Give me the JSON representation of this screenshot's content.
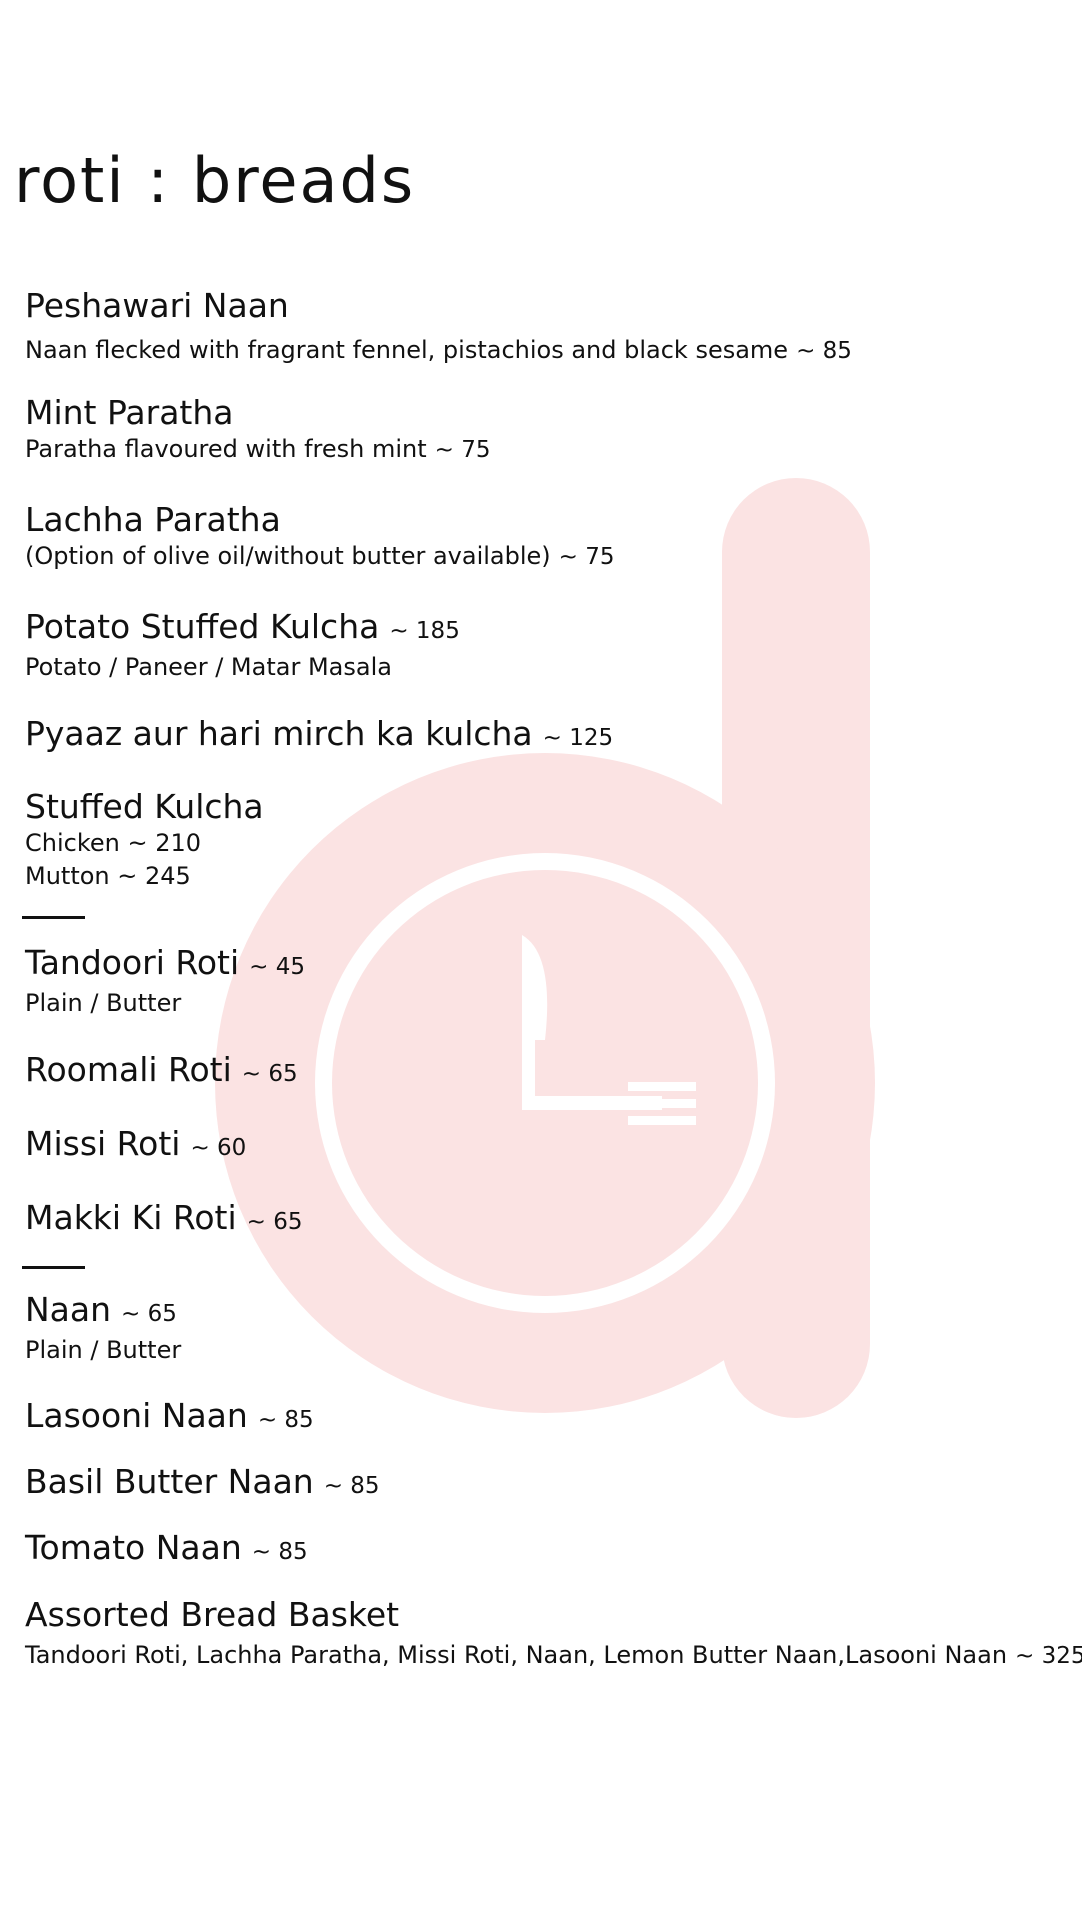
{
  "menu": {
    "title": "roti  :  breads",
    "items": [
      {
        "name": "Peshawari Naan",
        "desc": "Naan flecked with fragrant fennel, pistachios and black sesame",
        "desc_price": "~ 85"
      },
      {
        "name": "Mint Paratha",
        "desc": "Paratha flavoured with fresh mint",
        "desc_price": "~ 75"
      },
      {
        "name": "Lachha Paratha",
        "desc": "(Option of olive oil/without butter available)",
        "desc_price": "~ 75"
      },
      {
        "name": "Potato Stuffed Kulcha",
        "price": "~ 185",
        "desc": "Potato / Paneer / Matar Masala"
      },
      {
        "name": "Pyaaz aur hari mirch ka kulcha",
        "price": "~ 125"
      },
      {
        "name": "Stuffed Kulcha",
        "options": [
          "Chicken ~ 210",
          "Mutton ~ 245"
        ]
      },
      {
        "name": "Tandoori Roti",
        "price": "~ 45",
        "desc": "Plain / Butter"
      },
      {
        "name": "Roomali Roti",
        "price": "~ 65"
      },
      {
        "name": "Missi Roti",
        "price": "~ 60"
      },
      {
        "name": "Makki Ki Roti",
        "price": "~ 65"
      },
      {
        "name": "Naan",
        "price": "~ 65",
        "desc": "Plain / Butter"
      },
      {
        "name": "Lasooni Naan",
        "price": "~ 85"
      },
      {
        "name": "Basil Butter Naan",
        "price": "~ 85"
      },
      {
        "name": "Tomato Naan",
        "price": "~ 85"
      },
      {
        "name": "Assorted Bread Basket",
        "desc": "Tandoori Roti, Lachha Paratha, Missi Roti, Naan, Lemon Butter Naan,Lasooni Naan",
        "desc_price": "~ 325"
      }
    ]
  },
  "colors": {
    "text": "#111111",
    "watermark": "#fbe3e3",
    "background": "#ffffff"
  },
  "watermark": {
    "icon": "fork-knife-clock-d-logo-icon"
  }
}
